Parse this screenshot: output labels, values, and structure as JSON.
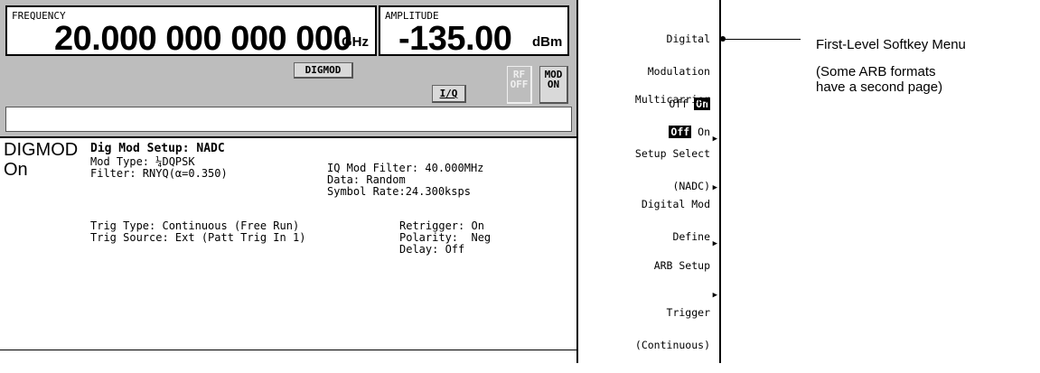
{
  "header": {
    "frequency_label": "FREQUENCY",
    "frequency_value": "20.000 000 000 000",
    "frequency_unit": "GHz",
    "amplitude_label": "AMPLITUDE",
    "amplitude_value": "-135.00",
    "amplitude_unit": "dBm",
    "annunciator_digmod": "DIGMOD",
    "annunciator_iq": "I/Q",
    "annunciator_rf_line1": "RF",
    "annunciator_rf_line2": "OFF",
    "annunciator_mod_line1": "MOD",
    "annunciator_mod_line2": "ON"
  },
  "display": {
    "state_title": "DIGMOD",
    "state_value": "On",
    "setup_title": "Dig Mod Setup: NADC",
    "mod_type": "Mod Type: ¼DQPSK",
    "filter": "Filter: RNYQ(α=0.350)",
    "iq_mod_filter": "IQ Mod Filter: 40.000MHz",
    "data": "Data: Random",
    "symbol_rate": "Symbol Rate:24.300ksps",
    "trig_type": "Trig Type: Continuous (Free Run)",
    "trig_source": "Trig Source: Ext (Patt Trig In 1)",
    "retrigger": "Retrigger: On",
    "polarity": "Polarity:  Neg",
    "delay": "Delay: Off"
  },
  "softkeys": {
    "k1_line1": "Digital",
    "k1_line2": "Modulation",
    "k1_off": "Off",
    "k1_on": "On",
    "k2_line1": "Multicarrier",
    "k2_off": "Off",
    "k2_on": "On",
    "k3_line1": "Setup Select",
    "k3_line2": "(NADC)",
    "k4_line1": "Digital Mod",
    "k4_line2": "Define",
    "k5_line1": "ARB Setup",
    "k6_line1": "Trigger",
    "k6_line2": "(Continuous)"
  },
  "callout": {
    "title": "First-Level Softkey Menu",
    "note_line1": "(Some ARB formats",
    "note_line2": "have a second page)"
  }
}
